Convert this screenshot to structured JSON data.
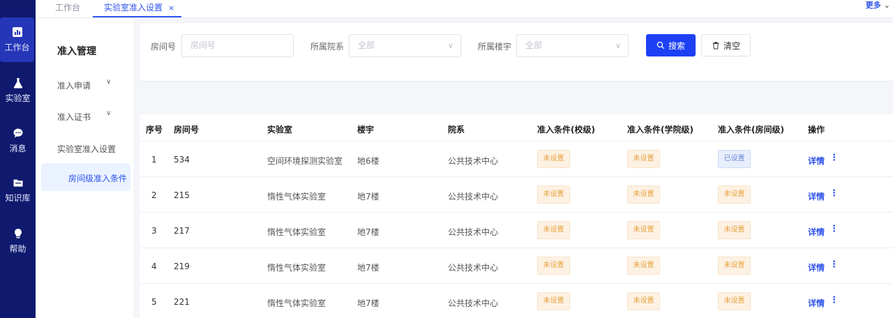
{
  "rail": {
    "items": [
      {
        "label": "工作台",
        "icon": "chart-icon"
      },
      {
        "label": "实验室",
        "icon": "flask-icon"
      },
      {
        "label": "消息",
        "icon": "message-icon"
      },
      {
        "label": "知识库",
        "icon": "folder-icon"
      },
      {
        "label": "帮助",
        "icon": "lightbulb-icon"
      }
    ]
  },
  "tabs": {
    "home": "工作台",
    "active": "实验室准入设置",
    "close": "×",
    "more": "更多"
  },
  "submenu": {
    "title": "准入管理",
    "items": [
      "准入申请",
      "准入证书",
      "实验室准入设置"
    ],
    "active_item": "房间级准入条件"
  },
  "filter": {
    "room_label": "房间号",
    "room_placeholder": "房间号",
    "dept_label": "所属院系",
    "dept_value": "全部",
    "building_label": "所属楼宇",
    "building_value": "全部",
    "search_label": "搜索",
    "clear_label": "清空"
  },
  "table": {
    "columns": [
      "序号",
      "房间号",
      "实验室",
      "楼宇",
      "院系",
      "准入条件(校级)",
      "准入条件(学院级)",
      "准入条件(房间级)",
      "操作"
    ],
    "rows": [
      {
        "idx": "1",
        "room": "534",
        "lab": "空间环境探测实验室",
        "building": "地6楼",
        "dept": "公共技术中心",
        "school": "未设置",
        "college": "未设置",
        "room_level": "已设置",
        "op": "详情"
      },
      {
        "idx": "2",
        "room": "215",
        "lab": "惰性气体实验室",
        "building": "地7楼",
        "dept": "公共技术中心",
        "school": "未设置",
        "college": "未设置",
        "room_level": "未设置",
        "op": "详情"
      },
      {
        "idx": "3",
        "room": "217",
        "lab": "惰性气体实验室",
        "building": "地7楼",
        "dept": "公共技术中心",
        "school": "未设置",
        "college": "未设置",
        "room_level": "未设置",
        "op": "详情"
      },
      {
        "idx": "4",
        "room": "219",
        "lab": "惰性气体实验室",
        "building": "地7楼",
        "dept": "公共技术中心",
        "school": "未设置",
        "college": "未设置",
        "room_level": "未设置",
        "op": "详情"
      },
      {
        "idx": "5",
        "room": "221",
        "lab": "惰性气体实验室",
        "building": "地7楼",
        "dept": "公共技术中心",
        "school": "未设置",
        "college": "未设置",
        "room_level": "未设置",
        "op": "详情"
      }
    ]
  },
  "colors": {
    "rail_bg": "#0f1a6e",
    "rail_active": "#2537b8",
    "primary": "#1e40f5",
    "badge_unset_text": "#e6a23c",
    "badge_set_text": "#6a87d6"
  }
}
